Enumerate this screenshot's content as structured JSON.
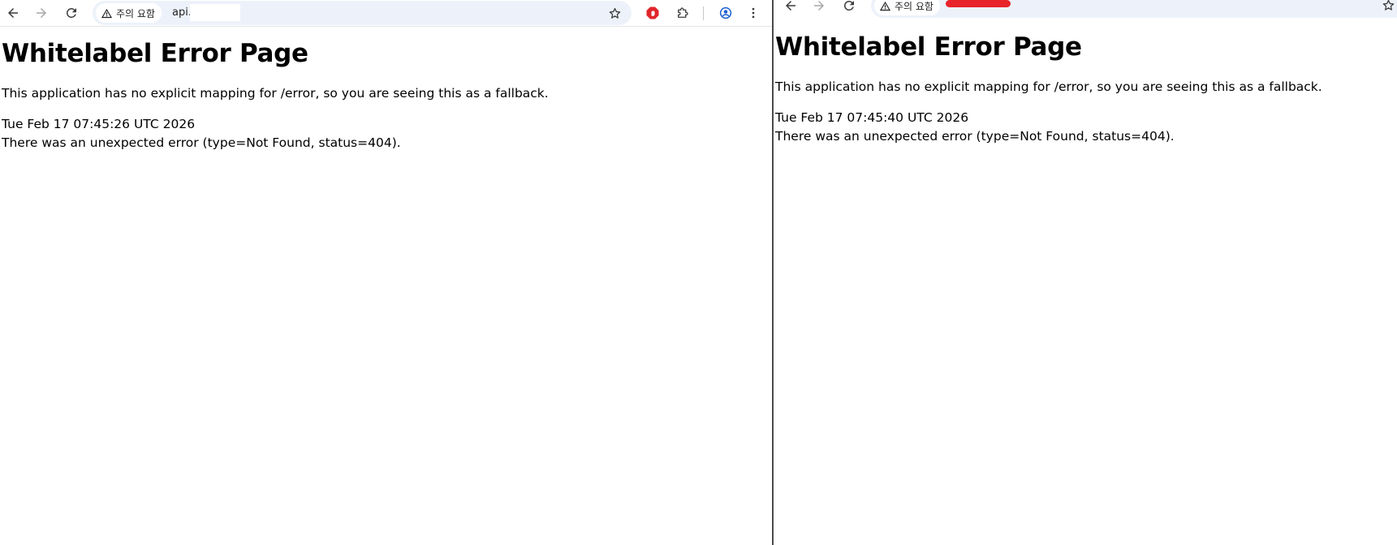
{
  "left_window": {
    "chip_label": "주의 요함",
    "url_visible": "api.",
    "page": {
      "title": "Whitelabel Error Page",
      "description": "This application has no explicit mapping for /error, so you are seeing this as a fallback.",
      "timestamp": "Tue Feb 17 07:45:26 UTC 2026",
      "error": "There was an unexpected error (type=Not Found, status=404)."
    }
  },
  "right_window": {
    "chip_label": "주의 요함",
    "page": {
      "title": "Whitelabel Error Page",
      "description": "This application has no explicit mapping for /error, so you are seeing this as a fallback.",
      "timestamp": "Tue Feb 17 07:45:40 UTC 2026",
      "error": "There was an unexpected error (type=Not Found, status=404)."
    }
  },
  "icons": {
    "back": "arrow-left",
    "forward": "arrow-right",
    "reload": "reload",
    "warning": "warning-triangle",
    "bookmark": "star",
    "adblock": "red-hand-stop",
    "extensions": "puzzle-piece",
    "profile": "person-circle",
    "menu": "three-dots-vertical"
  },
  "colors": {
    "omnibox_bg": "#edf2fa",
    "adblock_red": "#e0262b",
    "profile_blue": "#1a5fd0",
    "redaction_red": "#e8232a",
    "text": "#000000"
  }
}
